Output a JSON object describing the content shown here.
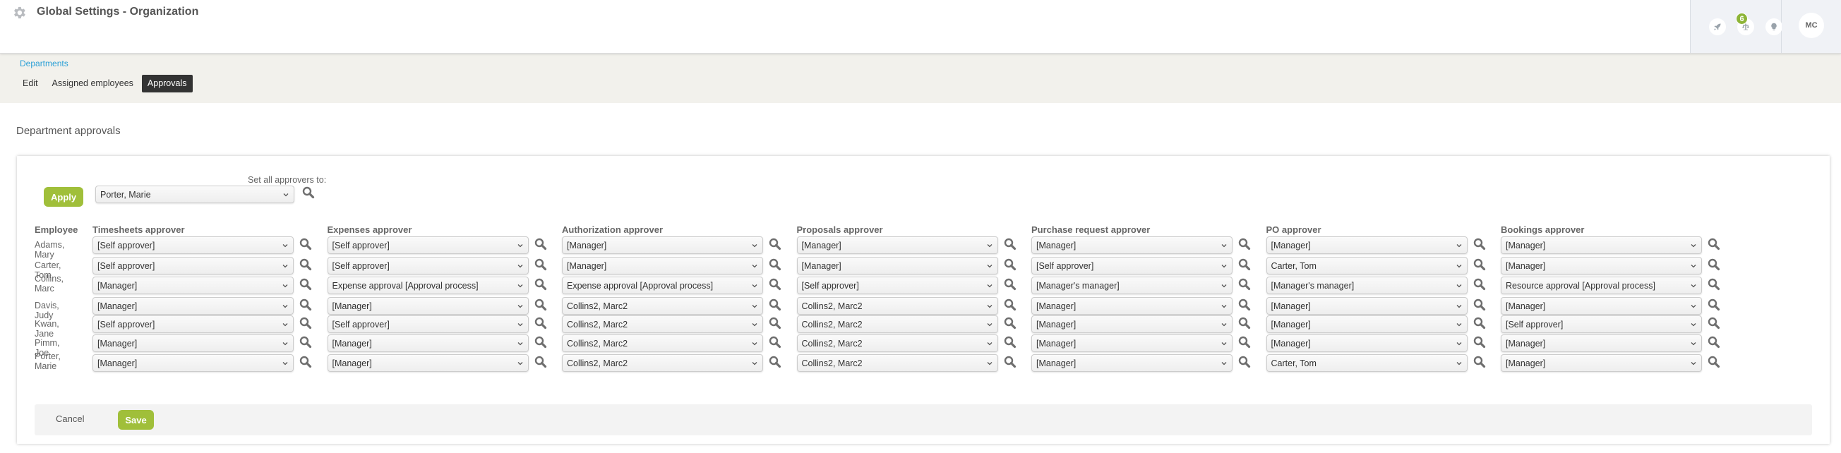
{
  "header": {
    "title": "Global Settings - Organization",
    "notification_count": "6",
    "user_initials": "MC",
    "icons": [
      "gear-icon",
      "rocket-icon",
      "scales-icon",
      "lightbulb-icon"
    ]
  },
  "breadcrumb": "Departments",
  "tabs": [
    {
      "label": "Edit",
      "active": false
    },
    {
      "label": "Assigned employees",
      "active": false
    },
    {
      "label": "Approvals",
      "active": true
    }
  ],
  "section_title": "Department approvals",
  "set_all": {
    "apply_label": "Apply",
    "label": "Set all approvers to:",
    "value": "Porter, Marie"
  },
  "table": {
    "employee_header": "Employee",
    "columns": [
      "Timesheets approver",
      "Expenses approver",
      "Authorization approver",
      "Proposals approver",
      "Purchase request approver",
      "PO approver",
      "Bookings approver"
    ],
    "rows": [
      {
        "employee": "Adams, Mary",
        "values": [
          "[Self approver]",
          "[Self approver]",
          "[Manager]",
          "[Manager]",
          "[Manager]",
          "[Manager]",
          "[Manager]"
        ]
      },
      {
        "employee": "Carter, Tom",
        "values": [
          "[Self approver]",
          "[Self approver]",
          "[Manager]",
          "[Manager]",
          "[Self approver]",
          "Carter, Tom",
          "[Manager]"
        ]
      },
      {
        "employee": "Collins, Marc",
        "values": [
          "[Manager]",
          "Expense approval [Approval process]",
          "Expense approval [Approval process]",
          "[Self approver]",
          "[Manager's manager]",
          "[Manager's manager]",
          "Resource approval [Approval process]"
        ]
      },
      {
        "employee": "Davis, Judy",
        "values": [
          "[Manager]",
          "[Manager]",
          "Collins2, Marc2",
          "Collins2, Marc2",
          "[Manager]",
          "[Manager]",
          "[Manager]"
        ]
      },
      {
        "employee": "Kwan, Jane",
        "values": [
          "[Self approver]",
          "[Self approver]",
          "Collins2, Marc2",
          "Collins2, Marc2",
          "[Manager]",
          "[Manager]",
          "[Self approver]"
        ]
      },
      {
        "employee": "Pimm, Joe",
        "values": [
          "[Manager]",
          "[Manager]",
          "Collins2, Marc2",
          "Collins2, Marc2",
          "[Manager]",
          "[Manager]",
          "[Manager]"
        ]
      },
      {
        "employee": "Porter, Marie",
        "values": [
          "[Manager]",
          "[Manager]",
          "Collins2, Marc2",
          "Collins2, Marc2",
          "[Manager]",
          "Carter, Tom",
          "[Manager]"
        ]
      }
    ]
  },
  "footer": {
    "cancel_label": "Cancel",
    "save_label": "Save"
  },
  "colors": {
    "accent_green": "#a0bf3a",
    "link_blue": "#2a9fd6",
    "active_tab": "#333333"
  }
}
